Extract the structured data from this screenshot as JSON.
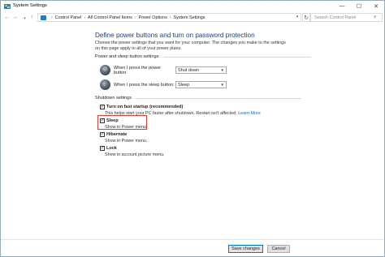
{
  "window": {
    "title": "System Settings",
    "controls": {
      "minimize": "—",
      "maximize": "☐",
      "close": "✕"
    }
  },
  "address_bar": {
    "crumbs": [
      "Control Panel",
      "All Control Panel Items",
      "Power Options",
      "System Settings"
    ],
    "separator": "›",
    "search_placeholder": "Search Control Panel"
  },
  "page": {
    "heading": "Define power buttons and turn on password protection",
    "description": "Choose the power settings that you want for your computer. The changes you make to the settings on this page apply to all of your power plans."
  },
  "power_sleep": {
    "section_title": "Power and sleep button settings:",
    "rows": [
      {
        "label": "When I press the power button:",
        "value": "Shut down"
      },
      {
        "label": "When I press the sleep button:",
        "value": "Sleep"
      }
    ]
  },
  "shutdown": {
    "section_title": "Shutdown settings",
    "options": [
      {
        "title": "Turn on fast startup (recommended)",
        "desc": "This helps start your PC faster after shutdown. Restart isn't affected.",
        "link": "Learn More",
        "checked": true
      },
      {
        "title": "Sleep",
        "desc": "Show in Power menu.",
        "checked": true
      },
      {
        "title": "Hibernate",
        "desc": "Show in Power menu.",
        "checked": true
      },
      {
        "title": "Lock",
        "desc": "Show in account picture menu.",
        "checked": true
      }
    ]
  },
  "footer": {
    "save_label": "Save changes",
    "cancel_label": "Cancel"
  },
  "colors": {
    "heading": "#1e3b8a",
    "highlight": "#e53935",
    "link": "#1565c0"
  }
}
